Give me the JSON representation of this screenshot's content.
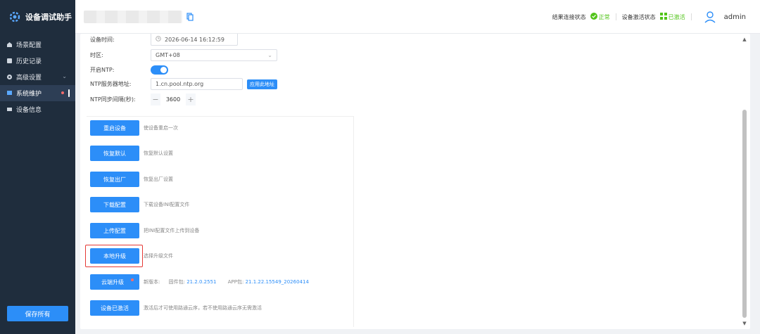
{
  "app": {
    "title": "设备调试助手"
  },
  "sidebar": {
    "items": [
      {
        "label": "场景配置",
        "icon": "scene-icon"
      },
      {
        "label": "历史记录",
        "icon": "history-icon"
      },
      {
        "label": "高级设置",
        "icon": "settings-icon"
      },
      {
        "label": "系统维护",
        "icon": "maintenance-icon"
      },
      {
        "label": "设备信息",
        "icon": "info-icon"
      }
    ],
    "save_all": "保存所有"
  },
  "header": {
    "result_status_label": "结果连接状态",
    "result_status_value": "正常",
    "activation_label": "设备激活状态",
    "activation_value": "已激活",
    "username": "admin"
  },
  "form": {
    "device_time_label": "设备时间:",
    "device_time_value": "2026-06-14 16:12:59",
    "timezone_label": "时区:",
    "timezone_value": "GMT+08",
    "ntp_enable_label": "开启NTP:",
    "ntp_enabled": true,
    "ntp_server_label": "NTP服务器地址:",
    "ntp_server_value": "1.cn.pool.ntp.org",
    "apply_label": "应用此地址",
    "ntp_interval_label": "NTP同步间隔(秒):",
    "ntp_interval_value": "3600"
  },
  "operations": [
    {
      "button": "重启设备",
      "desc": "使设备重启一次"
    },
    {
      "button": "恢复默认",
      "desc": "恢复默认设置"
    },
    {
      "button": "恢复出厂",
      "desc": "恢复出厂设置"
    },
    {
      "button": "下载配置",
      "desc": "下载设备INI配置文件"
    },
    {
      "button": "上传配置",
      "desc": "把INI配置文件上传到设备"
    },
    {
      "button": "本地升级",
      "desc": "选择升级文件"
    },
    {
      "button": "云端升级",
      "desc_prefix": "新版本:",
      "fw_label": "固件包:",
      "fw_value": "21.2.0.2551",
      "app_label": "APP包:",
      "app_value": "21.1.22.15549_20260414"
    },
    {
      "button": "设备已激活",
      "desc": "激活后才可使用路通云序，若不使用路通云序无需激活"
    }
  ],
  "colors": {
    "accent": "#2c8ef8",
    "sidebar_bg": "#1f2d3d",
    "ok": "#52c41a",
    "highlight": "#e53935"
  }
}
